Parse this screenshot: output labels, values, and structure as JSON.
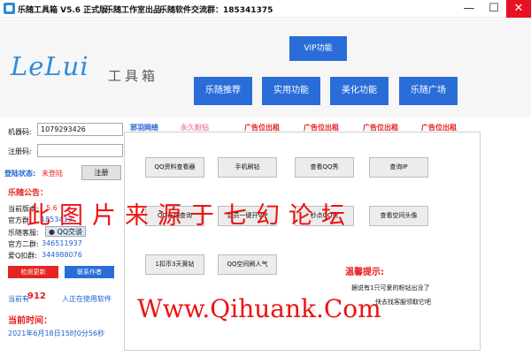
{
  "titlebar": {
    "app_name": "乐随工具箱 V5.6 正式版",
    "studio": "乐随工作室出品",
    "qq_group": "乐随软件交流群：185341375",
    "minimize": "—",
    "maximize": "☐",
    "close": "✕"
  },
  "logo": {
    "main": "LeLui",
    "sub": "工具箱"
  },
  "nav": {
    "vip": "VIP功能",
    "recommend": "乐随推荐",
    "practical": "实用功能",
    "beautify": "美化功能",
    "plaza": "乐随广场"
  },
  "ads": {
    "site": "邪羽网络",
    "pink": "永久粉钻",
    "slot1": "广告位出租",
    "slot2": "广告位出租",
    "slot3": "广告位出租",
    "slot4": "广告位出租"
  },
  "login": {
    "machine_label": "机器码:",
    "machine_value": "1079293426",
    "reg_label": "注册码:",
    "reg_value": "",
    "status_label": "登陆状态:",
    "status_value": "未登陆",
    "register_button": "注册"
  },
  "notice": {
    "title": "乐随公告：",
    "version_label": "当前版本:",
    "version_value": "5.6",
    "group_label": "官方群:",
    "group_value": "1853413",
    "service_label": "乐随客服:",
    "service_value": "QQ交谈",
    "group2_label": "官方二群:",
    "group2_value": "346511937",
    "group3_label": "爱Q扣群:",
    "group3_value": "344988076",
    "check_update": "检测更新",
    "contact_author": "联系作者"
  },
  "usage": {
    "prefix": "当前有",
    "count": "912",
    "suffix": "人正在使用软件"
  },
  "time": {
    "label": "当前时间：",
    "value": "2021年6月18日15时0分56秒"
  },
  "functions": {
    "b1": "QQ资料查看器",
    "b2": "手机刷钻",
    "b3": "查看QQ秀",
    "b4": "查询IP",
    "b5": "QQ在线查询",
    "b6": "会员一键开VIP",
    "b7": "秒点QQ赞",
    "b8": "查看空间头像",
    "b9": "1扣币3天黄钻",
    "b10": "QQ空间刷人气"
  },
  "tips": {
    "title": "温馨提示:",
    "line1": "据说有1只可爱的粉钻出没了",
    "line2": "快去找客服领取它吧"
  },
  "watermark": {
    "cn": "此图片来源于七幻论坛",
    "url": "Www.Qihuank.Com"
  },
  "colors": {
    "accent_blue": "#2a6dd9",
    "alert_red": "#e61e1e",
    "logo_blue": "#2e8cd8"
  }
}
